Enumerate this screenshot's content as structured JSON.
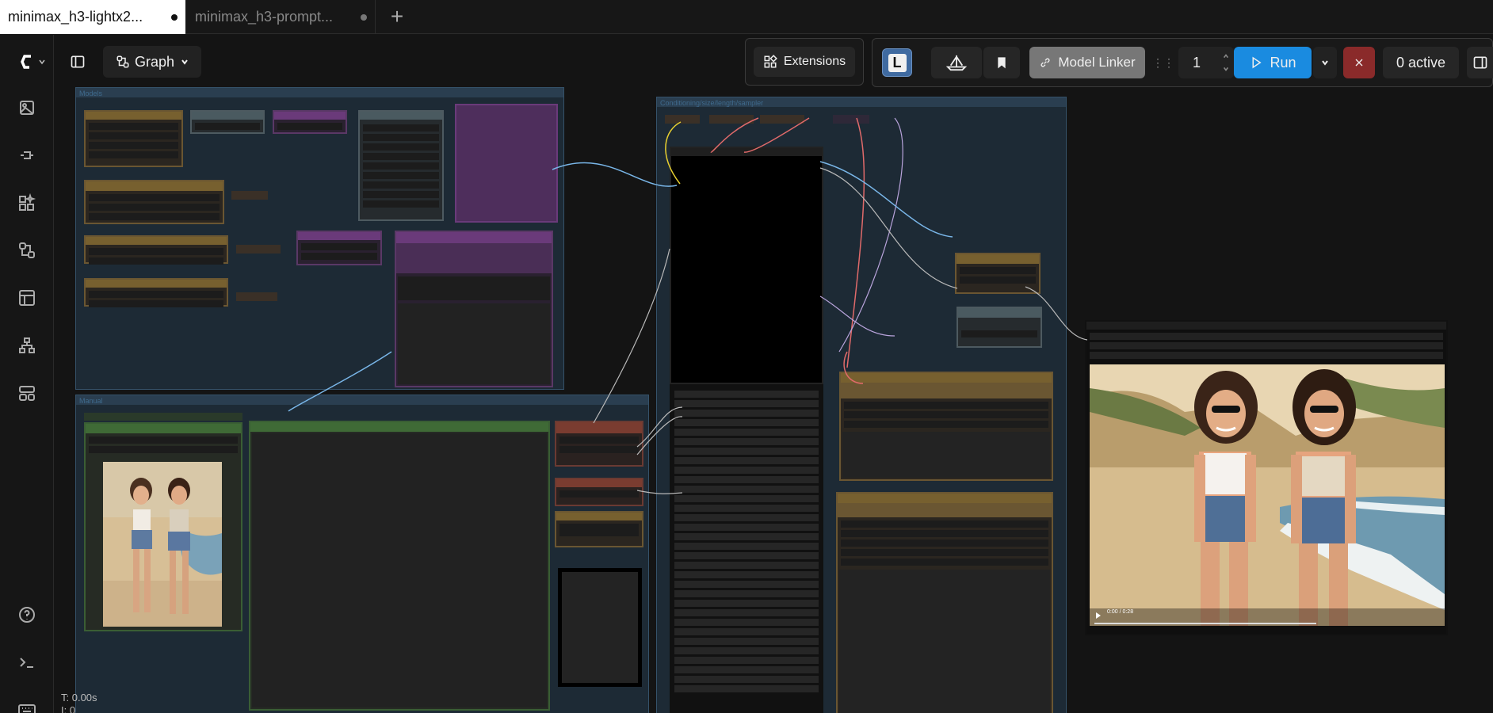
{
  "tabs": [
    {
      "label": "minimax_h3-lightx2...",
      "active": true
    },
    {
      "label": "minimax_h3-prompt...",
      "active": false
    }
  ],
  "toolbar": {
    "view_label": "Graph",
    "extensions_label": "Extensions",
    "logo_letter": "L",
    "model_linker_label": "Model Linker",
    "queue_count": "1",
    "run_label": "Run",
    "active_label": "0 active"
  },
  "groups": {
    "models": "Models",
    "manual": "Manual",
    "conditioning": "Conditioning/size/length/sampler"
  },
  "status": {
    "time": "T: 0.00s",
    "iter": "I: 0"
  },
  "video": {
    "time_label": "0:00 / 0:28"
  },
  "sidebar_icons": [
    "queue-icon",
    "node-library-icon",
    "model-library-icon",
    "workflows-icon",
    "templates-icon",
    "node-map-icon",
    "apps-icon",
    "help-icon",
    "terminal-icon",
    "keyboard-icon"
  ]
}
